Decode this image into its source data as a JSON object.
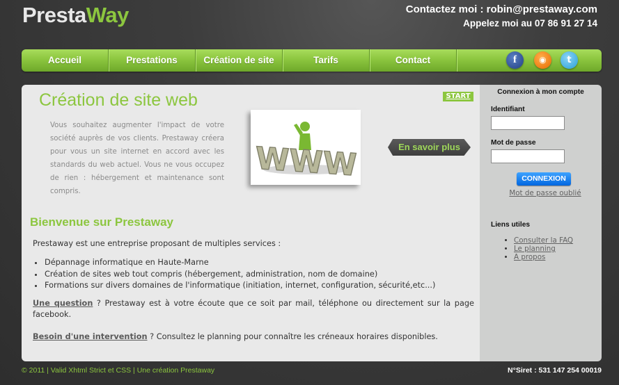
{
  "header": {
    "logo_part1": "Presta",
    "logo_part2": "Way",
    "contact_line": "Contactez moi : robin@prestaway.com",
    "phone_line": "Appelez moi au 07 86 91 27 14"
  },
  "nav": {
    "items": [
      {
        "label": "Accueil"
      },
      {
        "label": "Prestations"
      },
      {
        "label": "Création de site"
      },
      {
        "label": "Tarifs"
      },
      {
        "label": "Contact"
      }
    ],
    "social": [
      {
        "icon": "facebook-icon",
        "glyph": "f",
        "color": "#3b5998"
      },
      {
        "icon": "rss-icon",
        "glyph": "◉",
        "color": "#f57c00"
      },
      {
        "icon": "twitter-icon",
        "glyph": "t",
        "color": "#2a9fd8"
      }
    ]
  },
  "feature": {
    "title": "Création de site web",
    "start_label": "START",
    "description": "Vous souhaitez augmenter l'impact de votre société auprès de vos clients. Prestaway créera pour vous un site internet en accord avec les standards du web actuel. Vous ne vous occupez de rien : hébergement et maintenance sont compris.",
    "image_text": "WWW",
    "more_button": "En savoir plus"
  },
  "welcome": {
    "title": "Bienvenue sur Prestaway",
    "intro": "Prestaway est une entreprise proposant de multiples services :",
    "services": [
      "Dépannage informatique en Haute-Marne",
      "Création de sites web tout compris (hébergement, administration, nom de domaine)",
      "Formations sur divers domaines de l'informatique (initiation, internet, configuration, sécurité,etc...)"
    ],
    "question_link": "Une question",
    "question_text": " ? Prestaway est à votre écoute que ce soit par mail, téléphone ou directement sur la page facebook.",
    "intervention_link": "Besoin d'une intervention",
    "intervention_text": " ? Consultez le planning pour connaître les créneaux horaires disponibles."
  },
  "sidebar": {
    "login_title": "Connexion à mon compte",
    "id_label": "Identifiant",
    "id_value": "",
    "password_label": "Mot de passe",
    "password_value": "",
    "login_button": "CONNEXION",
    "forgot_link": "Mot de passe oublié",
    "links_title": "Liens utiles",
    "links": [
      {
        "label": "Consulter la FAQ"
      },
      {
        "label": "Le planning"
      },
      {
        "label": "A propos"
      }
    ]
  },
  "footer": {
    "left": "© 2011 | Valid Xhtml Strict et CSS | Une création Prestaway",
    "right": "N°Siret : 531 147 254 00019"
  },
  "colors": {
    "accent_green": "#8cc63f",
    "background_dark": "#333333",
    "content_bg": "#e9e9e9",
    "sidebar_bg": "#cfd0cf",
    "button_blue": "#0a7cf0"
  }
}
